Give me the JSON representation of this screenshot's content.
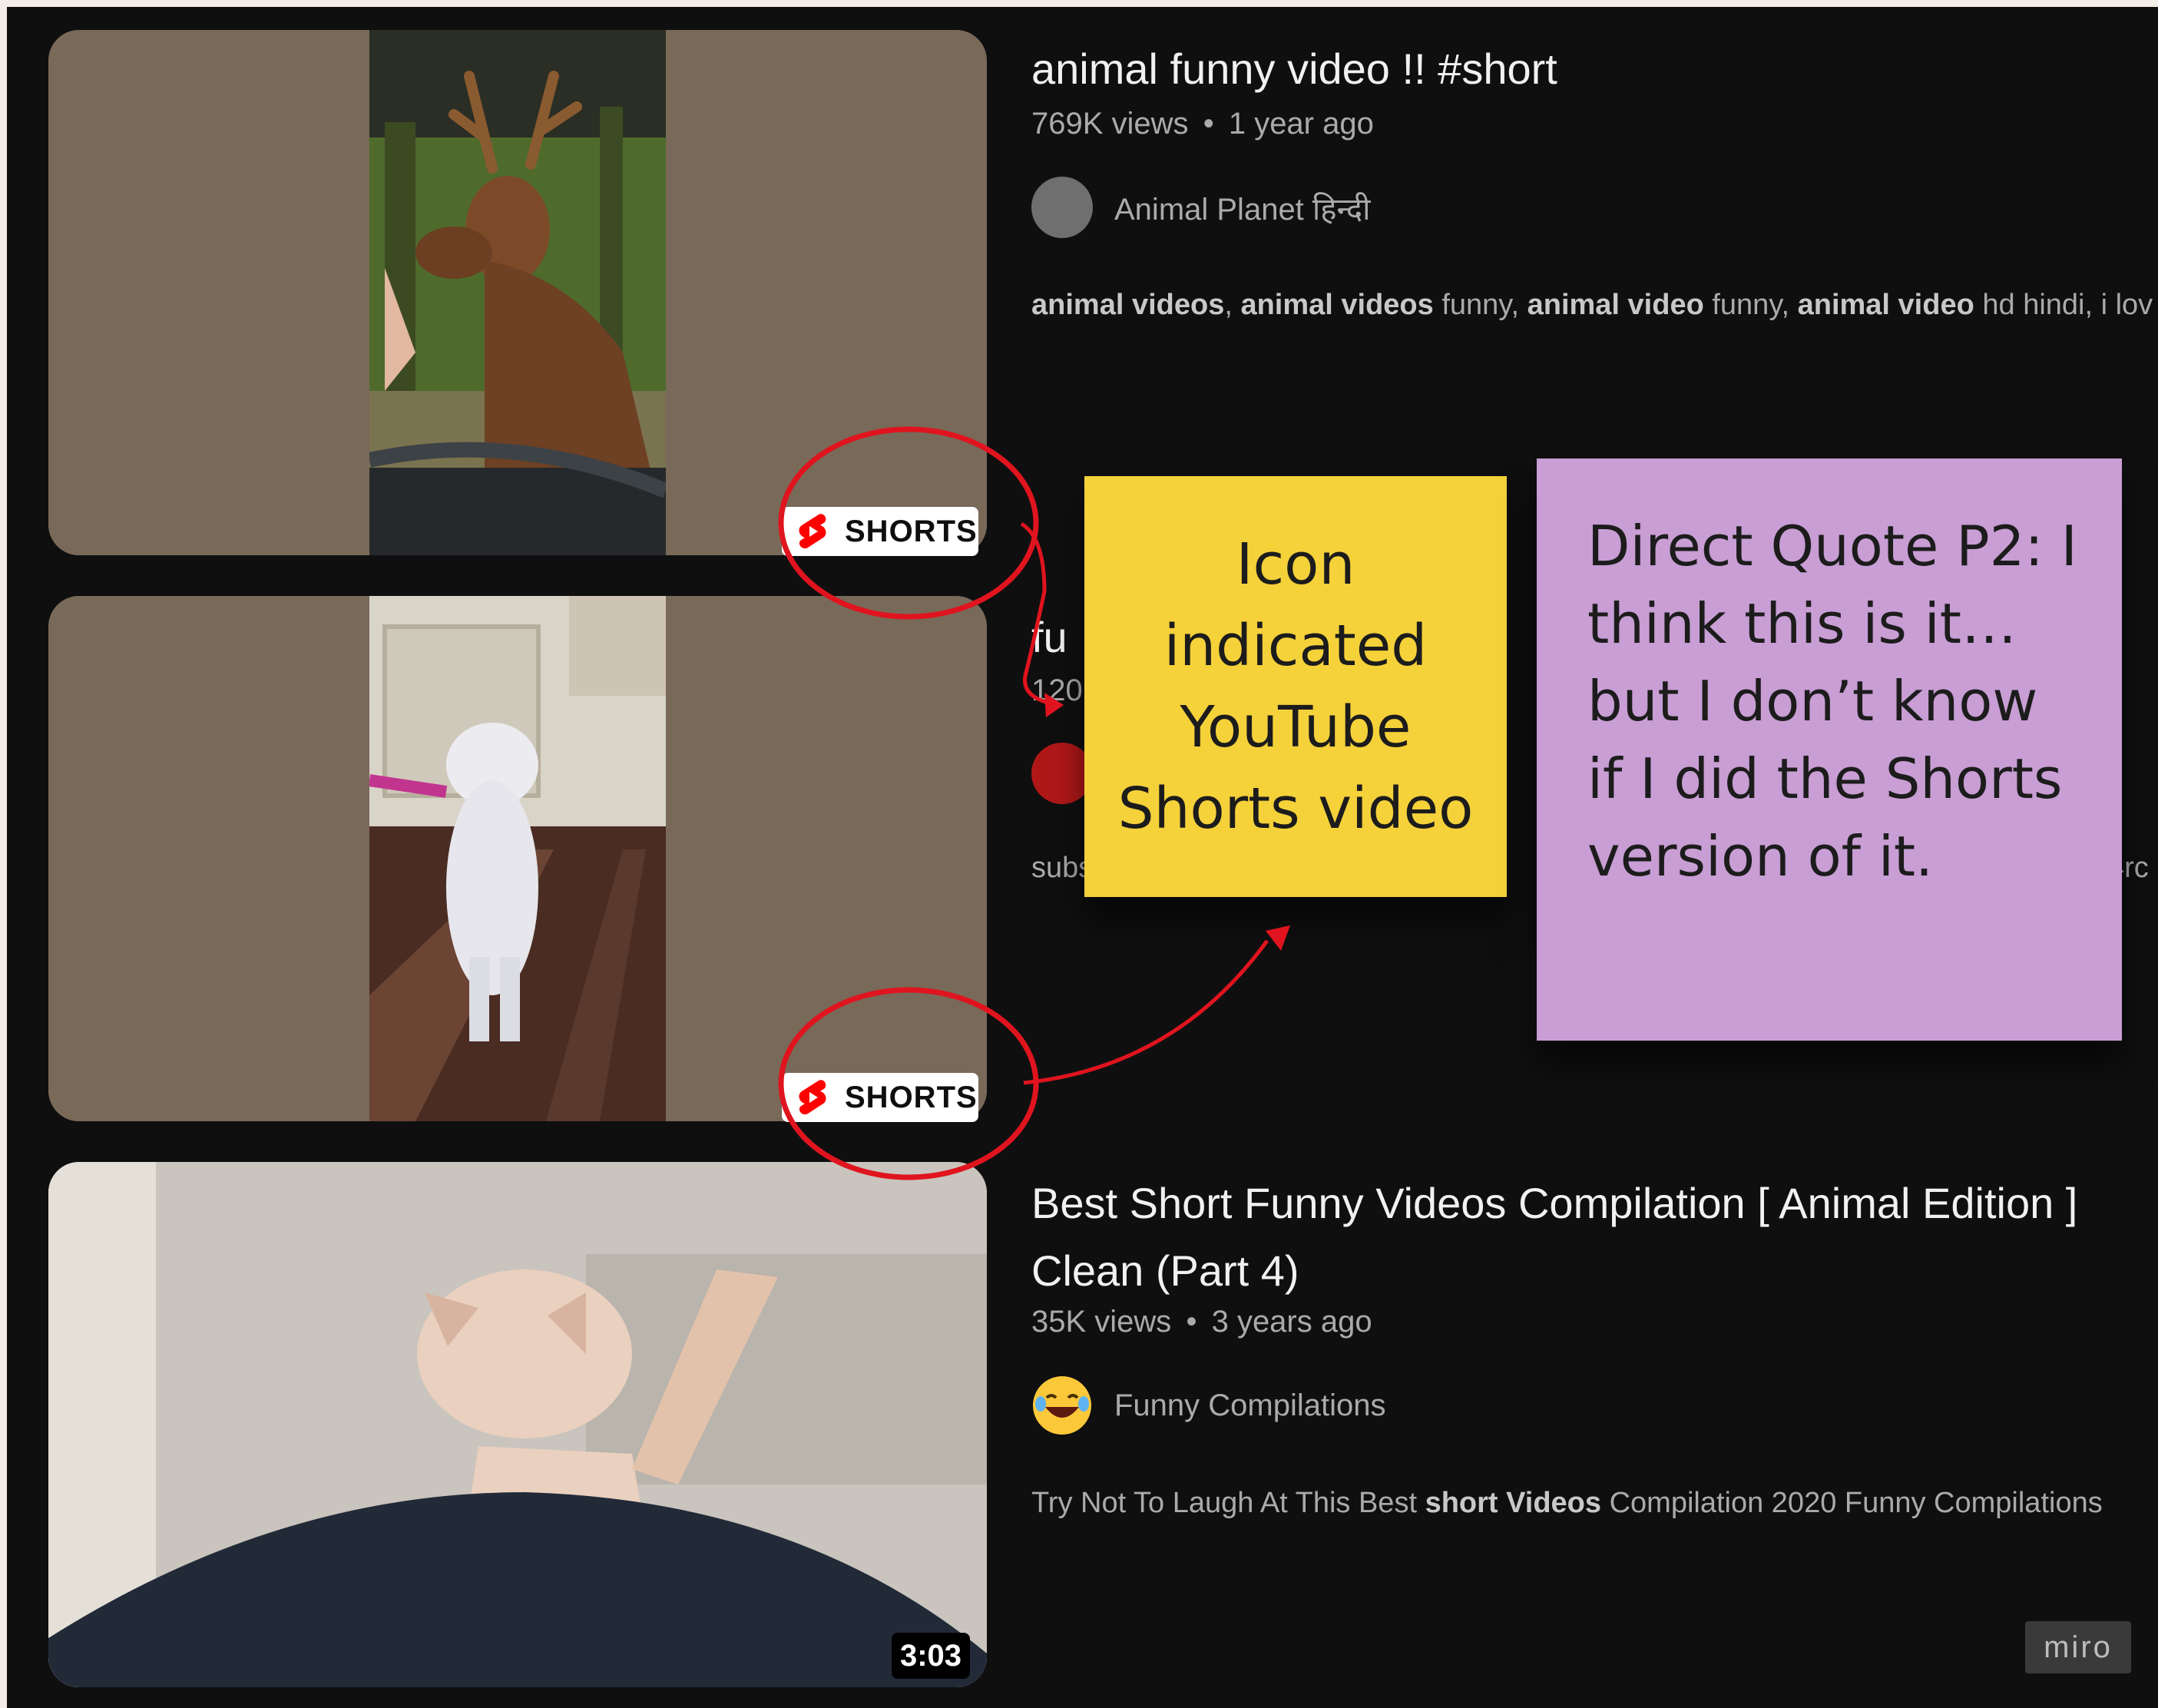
{
  "videos": [
    {
      "title": "animal funny video !! #short",
      "views": "769K views",
      "age": "1 year ago",
      "channel": "Animal Planet हिन्दी",
      "description_parts": [
        {
          "text": "animal videos",
          "bold": true
        },
        {
          "text": ", ",
          "bold": false
        },
        {
          "text": "animal videos",
          "bold": true
        },
        {
          "text": " funny, ",
          "bold": false
        },
        {
          "text": "animal video",
          "bold": true
        },
        {
          "text": " funny, ",
          "bold": false
        },
        {
          "text": "animal video",
          "bold": true
        },
        {
          "text": " hd hindi, i lov",
          "bold": false
        }
      ],
      "badge": "SHORTS"
    },
    {
      "title_partial": "fu",
      "views_partial": "120",
      "desc_partial": "subs",
      "desc_partial_end": "4rc",
      "badge": "SHORTS"
    },
    {
      "title_line1": "Best Short Funny Videos Compilation [ Animal Edition ]",
      "title_line2": "Clean (Part 4)",
      "views": "35K views",
      "age": "3 years ago",
      "channel": "Funny Compilations",
      "description_parts": [
        {
          "text": "Try Not To Laugh At This Best ",
          "bold": false
        },
        {
          "text": "short Videos",
          "bold": true
        },
        {
          "text": " Compilation 2020 Funny Compilations",
          "bold": false
        }
      ],
      "duration": "3:03"
    }
  ],
  "meta_separator": "•",
  "sticky_notes": {
    "yellow": "Icon indicated YouTube Shorts video",
    "purple": "Direct Quote P2: I think this is it…but I don’t know if I did the Shorts version of it."
  },
  "watermark": "miro",
  "colors": {
    "annotation_red": "#e0141e",
    "shorts_logo_red": "#ff0000",
    "sticky_yellow": "#f5d13a",
    "sticky_purple": "#c89ed4",
    "background": "#0f0f10"
  },
  "icons": [
    "shorts-logo-icon",
    "channel-avatar",
    "laughing-emoji-icon"
  ]
}
